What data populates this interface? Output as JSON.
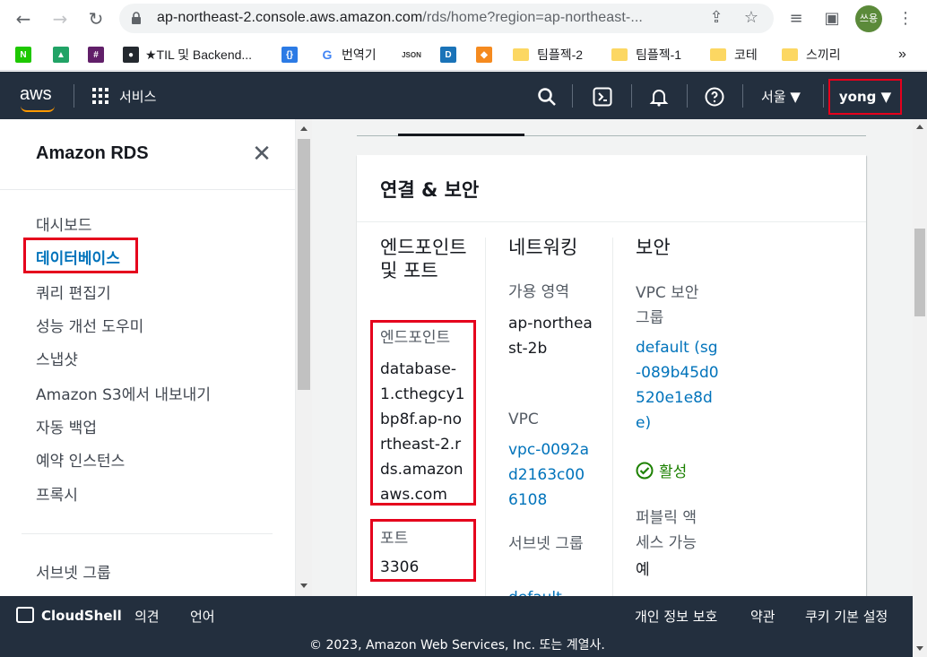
{
  "browser": {
    "url_host": "ap-northeast-2.console.aws.amazon.com",
    "url_rest": "/rds/home?region=ap-northeast-...",
    "avatar_label": "쓰용",
    "bookmarks": [
      {
        "label": "★TIL 및 Backend..."
      },
      {
        "label": "번역기"
      },
      {
        "label": "팀플젝-2"
      },
      {
        "label": "팀플젝-1"
      },
      {
        "label": "코테"
      },
      {
        "label": "스끼리"
      }
    ]
  },
  "aws_header": {
    "logo": "aws",
    "services_label": "서비스",
    "region_label": "서울 ▼",
    "user_label": "yong ▼"
  },
  "sidebar": {
    "title": "Amazon RDS",
    "items": [
      {
        "label": "대시보드"
      },
      {
        "label": "데이터베이스"
      },
      {
        "label": "쿼리 편집기"
      },
      {
        "label": "성능 개선 도우미"
      },
      {
        "label": "스냅샷"
      },
      {
        "label": "Amazon S3에서 내보내기"
      },
      {
        "label": "자동 백업"
      },
      {
        "label": "예약 인스턴스"
      },
      {
        "label": "프록시"
      },
      {
        "label": "서브넷 그룹"
      }
    ]
  },
  "card": {
    "title": "연결 & 보안",
    "endpoint_col": {
      "heading": "엔드포인트 및 포트",
      "endpoint_label": "엔드포인트",
      "endpoint_value": "database-1.cthegcy1bp8f.ap-northeast-2.rds.amazonaws.com",
      "port_label": "포트",
      "port_value": "3306"
    },
    "network_col": {
      "heading": "네트워킹",
      "az_label": "가용 영역",
      "az_value": "ap-northeast-2b",
      "vpc_label": "VPC",
      "vpc_value": "vpc-0092ad2163c006108",
      "subnet_label": "서브넷 그룹",
      "subnet_value": "default"
    },
    "security_col": {
      "heading": "보안",
      "sg_label": "VPC 보안 그룹",
      "sg_value": "default (sg-089b45d0520e1e8de)",
      "status": "활성",
      "public_label": "퍼블릭 액세스 가능",
      "public_value": "예"
    }
  },
  "footer": {
    "cloudshell": "CloudShell",
    "feedback": "의견",
    "language": "언어",
    "privacy": "개인 정보 보호",
    "terms": "약관",
    "cookies": "쿠키 기본 설정",
    "copyright": "© 2023, Amazon Web Services, Inc. 또는 계열사."
  }
}
